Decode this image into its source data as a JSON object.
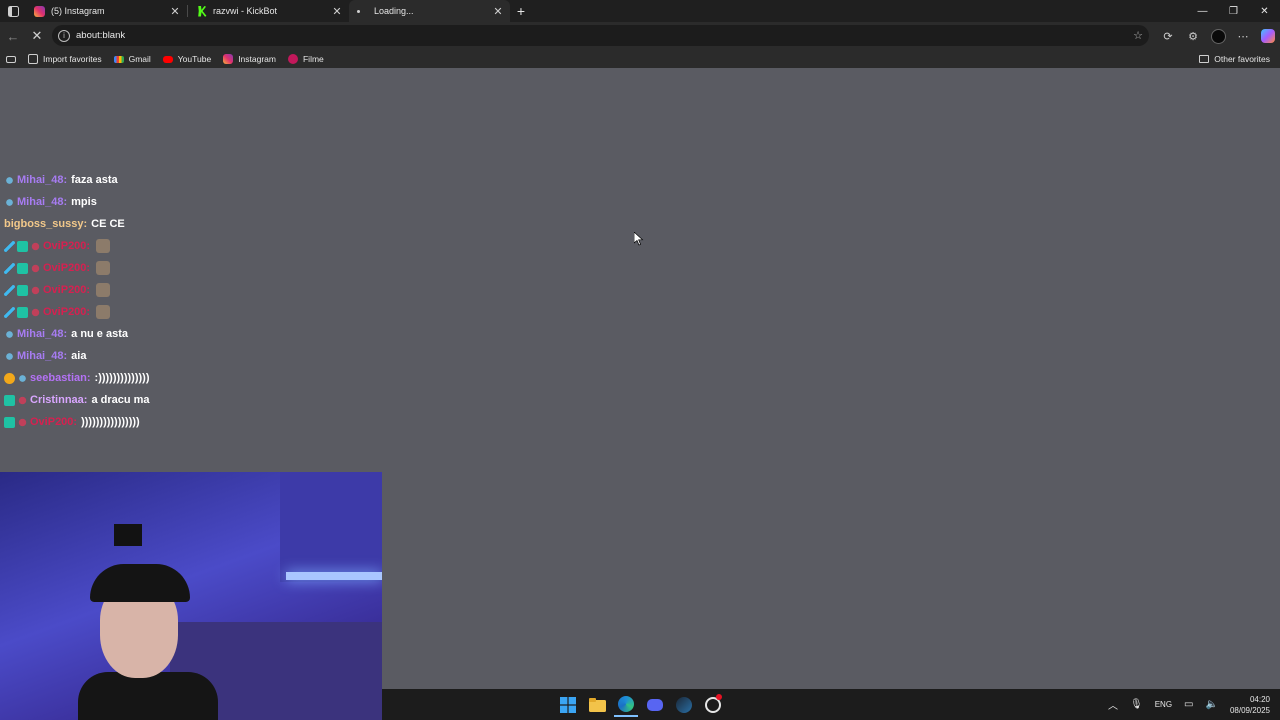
{
  "browser": {
    "tabs": [
      {
        "title": "(5) Instagram",
        "favicon": "instagram-icon",
        "active": false
      },
      {
        "title": "razvwi - KickBot",
        "favicon": "kickbot-icon",
        "active": false
      },
      {
        "title": "Loading...",
        "favicon": "loading-dot-icon",
        "active": true
      }
    ],
    "new_tab": "+",
    "address": "about:blank",
    "bookmarks": [
      {
        "label": "Import favorites",
        "icon": "import-icon"
      },
      {
        "label": "Gmail",
        "icon": "gmail-icon"
      },
      {
        "label": "YouTube",
        "icon": "youtube-icon"
      },
      {
        "label": "Instagram",
        "icon": "instagram-icon"
      },
      {
        "label": "Filme",
        "icon": "filme-icon"
      }
    ],
    "other_favorites": "Other favorites"
  },
  "chat": {
    "messages": [
      {
        "user": "Mihai_48:",
        "user_color": "#a77cf2",
        "badges": [
          "gem"
        ],
        "text": "faza asta",
        "emotes": 0
      },
      {
        "user": "Mihai_48:",
        "user_color": "#a77cf2",
        "badges": [
          "gem"
        ],
        "text": "mpis",
        "emotes": 0
      },
      {
        "user": "bigboss_sussy:",
        "user_color": "#f2c88a",
        "badges": [],
        "text": "CE CE",
        "emotes": 0
      },
      {
        "user": "OviP200:",
        "user_color": "#d62050",
        "badges": [
          "sword",
          "sub",
          "bat"
        ],
        "text": "",
        "emotes": 1
      },
      {
        "user": "OviP200:",
        "user_color": "#d62050",
        "badges": [
          "sword",
          "sub",
          "bat"
        ],
        "text": "",
        "emotes": 1
      },
      {
        "user": "OviP200:",
        "user_color": "#d62050",
        "badges": [
          "sword",
          "sub",
          "bat"
        ],
        "text": "",
        "emotes": 1
      },
      {
        "user": "OviP200:",
        "user_color": "#d62050",
        "badges": [
          "sword",
          "sub",
          "bat"
        ],
        "text": "",
        "emotes": 1
      },
      {
        "user": "Mihai_48:",
        "user_color": "#a77cf2",
        "badges": [
          "gem"
        ],
        "text": "a nu e asta",
        "emotes": 0
      },
      {
        "user": "Mihai_48:",
        "user_color": "#a77cf2",
        "badges": [
          "gem"
        ],
        "text": "aia",
        "emotes": 0
      },
      {
        "user": "seebastian:",
        "user_color": "#b472f5",
        "badges": [
          "one",
          "gem"
        ],
        "text": ":))))))))))))))",
        "emotes": 0
      },
      {
        "user": "Cristinnaa:",
        "user_color": "#d9a6ff",
        "badges": [
          "sub",
          "bat"
        ],
        "text": "a dracu ma",
        "emotes": 0
      },
      {
        "user": "OviP200:",
        "user_color": "#d62050",
        "badges": [
          "sub",
          "bat"
        ],
        "text": "))))))))))))))))",
        "emotes": 0
      }
    ]
  },
  "taskbar": {
    "apps": [
      "windows-start-icon",
      "file-explorer-icon",
      "edge-icon",
      "discord-icon",
      "steam-icon",
      "obs-icon"
    ],
    "language": "ENG",
    "time": "04:20",
    "date": "08/09/2025"
  }
}
